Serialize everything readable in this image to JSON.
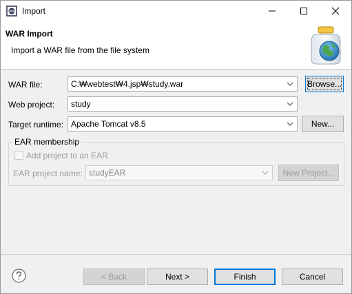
{
  "window": {
    "title": "Import",
    "minimize_icon": "minimize-icon",
    "maximize_icon": "maximize-icon",
    "close_icon": "close-icon"
  },
  "banner": {
    "title": "WAR Import",
    "description": "Import a WAR file from the file system",
    "graphic_icon": "jar-globe-icon"
  },
  "form": {
    "war_file": {
      "label": "WAR file:",
      "value": "C:₩webtest₩4.jsp₩study.war",
      "browse_label": "Browse..."
    },
    "web_project": {
      "label": "Web project:",
      "value": "study"
    },
    "target_runtime": {
      "label": "Target runtime:",
      "value": "Apache Tomcat v8.5",
      "new_label": "New..."
    },
    "ear": {
      "group_label": "EAR membership",
      "add_checkbox_label": "Add project to an EAR",
      "add_checked": false,
      "project_name_label": "EAR project name:",
      "project_name_value": "studyEAR",
      "new_project_label": "New Project..."
    }
  },
  "footer": {
    "help_icon": "help-icon",
    "back_label": "< Back",
    "next_label": "Next >",
    "finish_label": "Finish",
    "cancel_label": "Cancel"
  },
  "colors": {
    "accent": "#0078d7",
    "dialog_background": "#f0f0f0",
    "disabled_text": "#9b9b9b"
  }
}
